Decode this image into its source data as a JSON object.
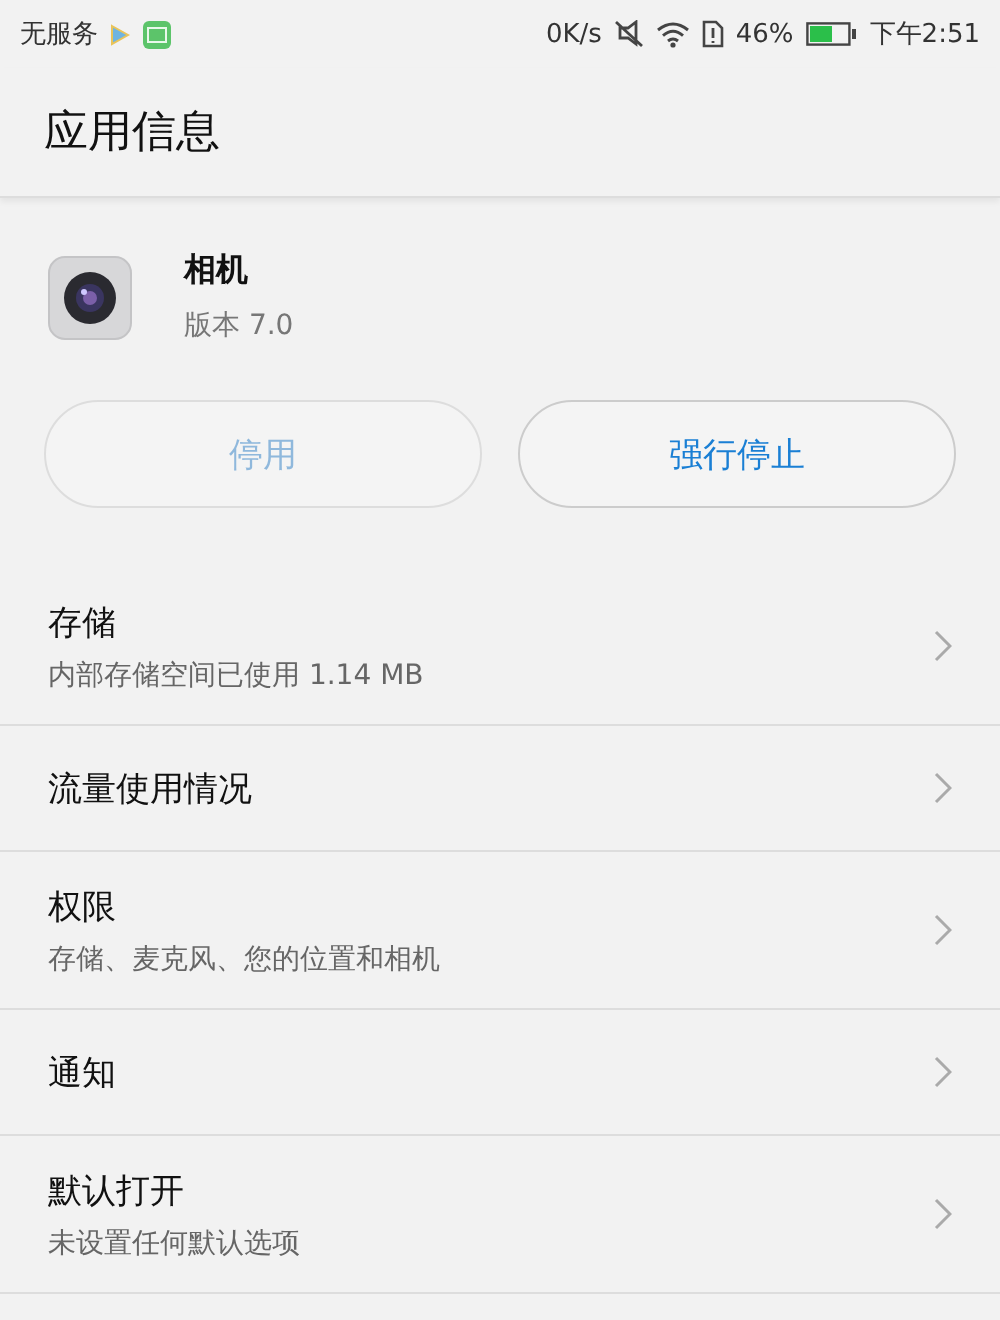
{
  "status_bar": {
    "carrier": "无服务",
    "speed": "0K/s",
    "battery_percent": "46%",
    "time": "下午2:51"
  },
  "title": "应用信息",
  "app": {
    "name": "相机",
    "version": "版本 7.0"
  },
  "buttons": [
    {
      "label": "停用",
      "disabled": true
    },
    {
      "label": "强行停止",
      "disabled": false
    }
  ],
  "rows": [
    {
      "title": "存储",
      "subtitle": "内部存储空间已使用 1.14 MB"
    },
    {
      "title": "流量使用情况"
    },
    {
      "title": "权限",
      "subtitle": "存储、麦克风、您的位置和相机"
    },
    {
      "title": "通知"
    },
    {
      "title": "默认打开",
      "subtitle": "未设置任何默认选项"
    }
  ]
}
